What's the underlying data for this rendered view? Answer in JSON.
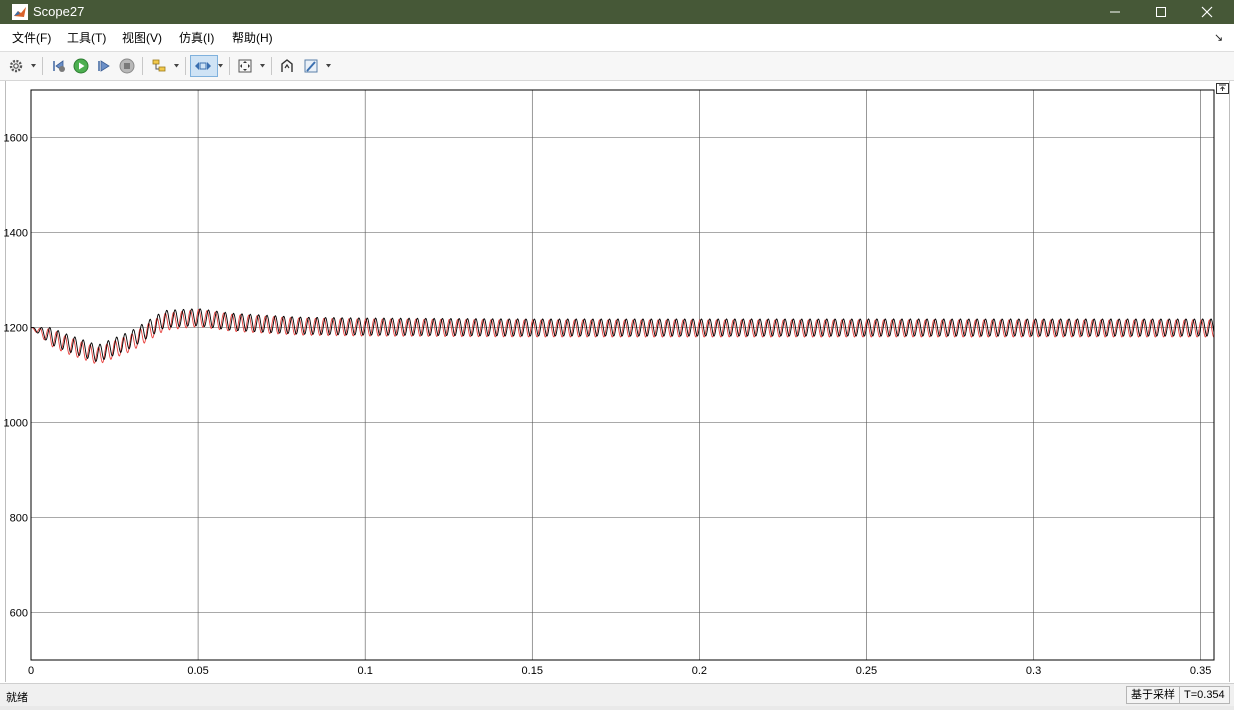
{
  "window": {
    "title": "Scope27"
  },
  "menu": {
    "items": [
      "文件(F)",
      "工具(T)",
      "视图(V)",
      "仿真(I)",
      "帮助(H)"
    ]
  },
  "toolbar": {
    "icons": [
      "gear-icon",
      "step-back-icon",
      "run-icon",
      "step-forward-icon",
      "stop-icon",
      "signal-select-icon",
      "zoom-icon",
      "fit-icon",
      "style-icon",
      "highlight-icon"
    ]
  },
  "statusbar": {
    "status": "就绪",
    "sample_mode": "基于采样",
    "time": "T=0.354"
  },
  "colors": {
    "titlebar": "#465837",
    "series_black": "#000000",
    "series_red": "#e8403c",
    "grid": "#bfbfbf"
  },
  "chart_data": {
    "type": "line",
    "title": "",
    "xlabel": "",
    "ylabel": "",
    "xlim": [
      0,
      0.354
    ],
    "ylim": [
      500,
      1700
    ],
    "xticks": [
      0,
      0.05,
      0.1,
      0.15,
      0.2,
      0.25,
      0.3,
      0.35
    ],
    "xtick_labels": [
      "0",
      "0.05",
      "0.1",
      "0.15",
      "0.2",
      "0.25",
      "0.3",
      "0.35"
    ],
    "yticks": [
      600,
      800,
      1000,
      1200,
      1400,
      1600
    ],
    "ytick_labels": [
      "600",
      "800",
      "1000",
      "1200",
      "1400",
      "1600"
    ],
    "grid": true,
    "legend": "none",
    "series": [
      {
        "color": "#000000",
        "description": "oscillating signal around setpoint",
        "x": [
          0,
          0.01,
          0.02,
          0.03,
          0.04,
          0.05,
          0.06,
          0.08,
          0.1,
          0.15,
          0.2,
          0.25,
          0.3,
          0.354
        ],
        "values": [
          1200,
          1170,
          1145,
          1175,
          1218,
          1222,
          1212,
          1204,
          1202,
          1200,
          1200,
          1200,
          1200,
          1200
        ],
        "oscillation_amplitude": 18,
        "oscillation_period": 0.0025
      },
      {
        "color": "#e8403c",
        "description": "oscillating signal around setpoint (phase shifted)",
        "x": [
          0,
          0.01,
          0.02,
          0.03,
          0.04,
          0.05,
          0.06,
          0.08,
          0.1,
          0.15,
          0.2,
          0.25,
          0.3,
          0.354
        ],
        "values": [
          1200,
          1165,
          1140,
          1168,
          1212,
          1220,
          1210,
          1202,
          1200,
          1198,
          1198,
          1198,
          1198,
          1198
        ],
        "oscillation_amplitude": 18,
        "oscillation_period": 0.0025
      }
    ]
  }
}
